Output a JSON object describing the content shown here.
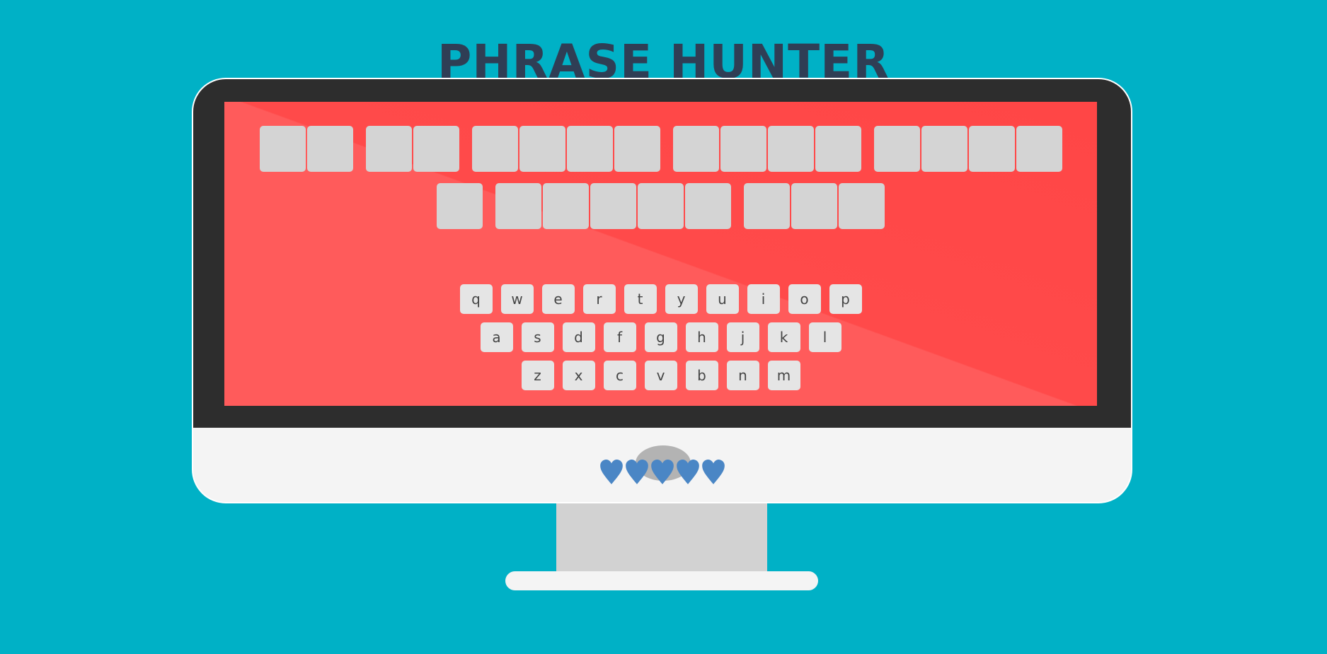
{
  "title": "PHRASE HUNTER",
  "phrase": {
    "words": [
      2,
      2,
      4,
      4,
      4,
      1,
      5,
      3
    ]
  },
  "keyboard": {
    "rows": [
      [
        "q",
        "w",
        "e",
        "r",
        "t",
        "y",
        "u",
        "i",
        "o",
        "p"
      ],
      [
        "a",
        "s",
        "d",
        "f",
        "g",
        "h",
        "j",
        "k",
        "l"
      ],
      [
        "z",
        "x",
        "c",
        "v",
        "b",
        "n",
        "m"
      ]
    ]
  },
  "lives": {
    "count": 5,
    "heart_icon": "heart-icon",
    "color": "#4a86c5"
  },
  "colors": {
    "background": "#00b1c6",
    "screen": "#ff5b5b",
    "tile": "#d4d4d4",
    "key": "#e5e5e5"
  }
}
